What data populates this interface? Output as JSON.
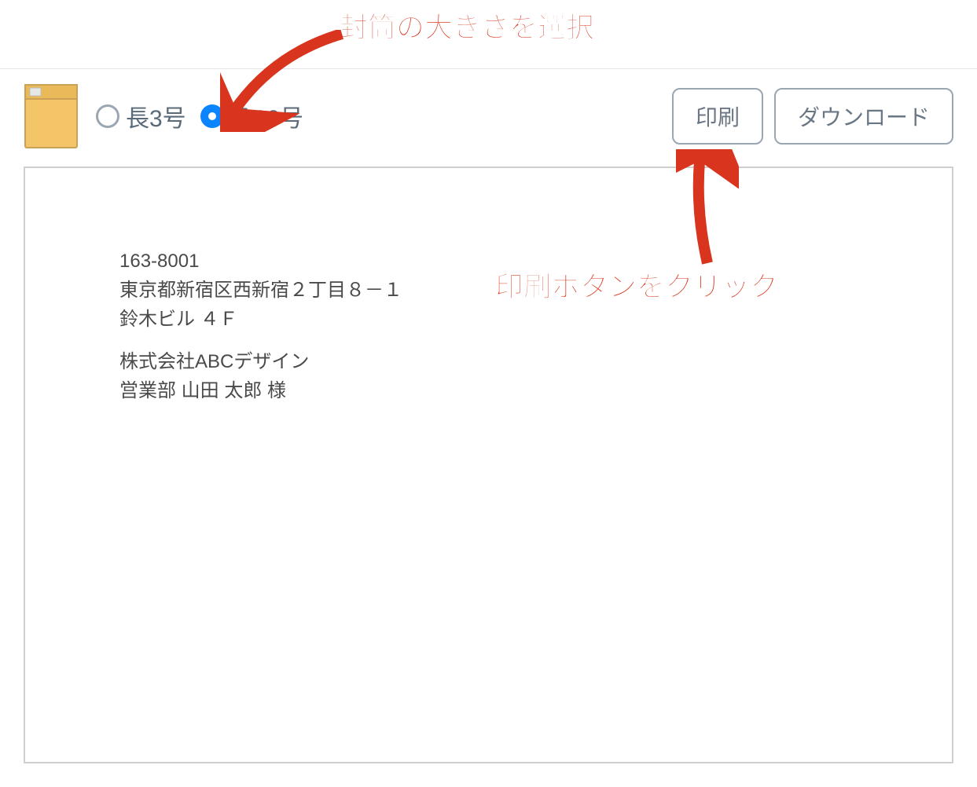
{
  "annotations": {
    "select_size": "封筒の大きさを選択",
    "click_print": "印刷ボタンをクリック"
  },
  "toolbar": {
    "sizes": [
      {
        "label": "長3号",
        "value": "naga3",
        "checked": false
      },
      {
        "label": "角20号",
        "value": "kaku20",
        "checked": true
      }
    ],
    "buttons": {
      "print": "印刷",
      "download": "ダウンロード"
    }
  },
  "envelope_preview": {
    "postal_code": "163-8001",
    "address_1": "東京都新宿区西新宿２丁目８－１",
    "address_2": "鈴木ビル ４Ｆ",
    "company": "株式会社ABCデザイン",
    "recipient": "営業部 山田 太郎 様"
  }
}
